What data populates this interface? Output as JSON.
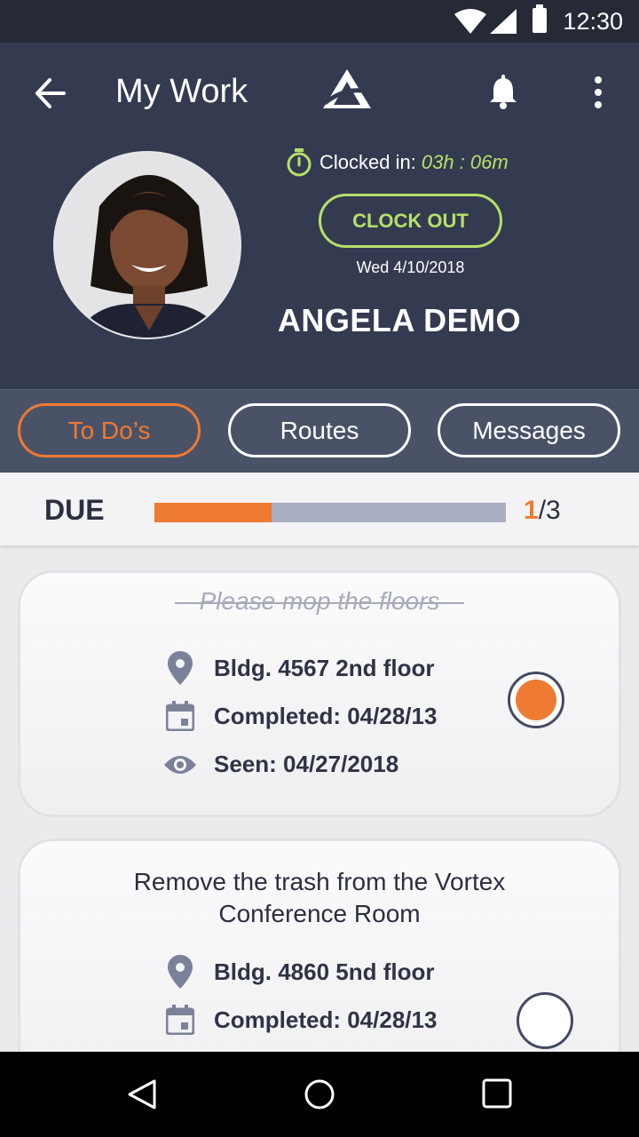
{
  "status_bar": {
    "time": "12:30"
  },
  "header": {
    "title": "My Work"
  },
  "profile": {
    "clocked_label": "Clocked in:",
    "clocked_duration": "03h : 06m",
    "clock_out_label": "CLOCK OUT",
    "date": "Wed 4/10/2018",
    "name": "ANGELA DEMO"
  },
  "tabs": [
    {
      "label": "To Do’s",
      "active": true
    },
    {
      "label": "Routes",
      "active": false
    },
    {
      "label": "Messages",
      "active": false
    }
  ],
  "due": {
    "label": "DUE",
    "completed": "1",
    "total": "/3",
    "progress_fraction": 0.333
  },
  "tasks": [
    {
      "title": "Please mop the floors",
      "done": true,
      "location": "Bldg. 4567 2nd floor",
      "completed": "Completed: 04/28/13",
      "seen": "Seen: 04/27/2018"
    },
    {
      "title_line1": "Remove the trash from the Vortex",
      "title_line2": "Conference Room",
      "done": false,
      "location": "Bldg. 4860 5nd floor",
      "completed": "Completed: 04/28/13"
    }
  ],
  "colors": {
    "accent": "#ef7a32",
    "clock_green": "#b6e06a",
    "header_bg": "#343a4f",
    "tabs_bg": "#4a5268"
  },
  "icons": [
    "wifi-icon",
    "signal-icon",
    "battery-icon",
    "back-arrow-icon",
    "logo-icon",
    "bell-icon",
    "more-vert-icon",
    "timer-icon",
    "location-pin-icon",
    "calendar-icon",
    "eye-icon",
    "nav-back-icon",
    "nav-home-icon",
    "nav-recents-icon"
  ]
}
